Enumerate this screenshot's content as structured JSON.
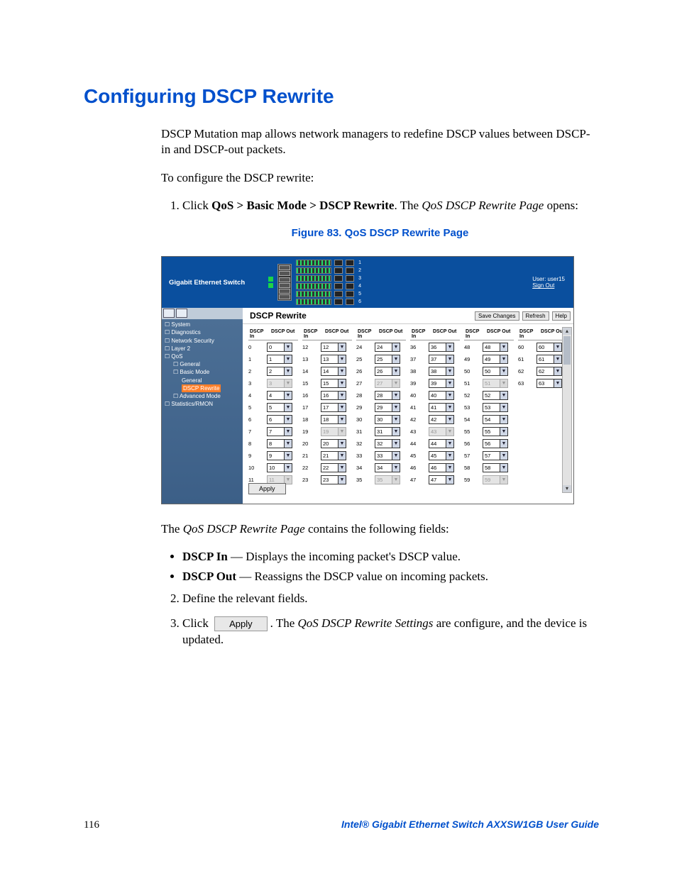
{
  "section_title": "Configuring DSCP Rewrite",
  "intro_paragraph": "DSCP Mutation map allows network managers to redefine DSCP values between DSCP-in and DSCP-out packets.",
  "procedure_intro": "To configure the DSCP rewrite:",
  "steps": {
    "s1_pre": "Click ",
    "s1_path": "QoS > Basic Mode > DSCP Rewrite",
    "s1_mid": ". The ",
    "s1_italic": "QoS DSCP Rewrite Page",
    "s1_post": " opens:",
    "s2": "Define the relevant fields.",
    "s3_pre": "Click ",
    "s3_mid": ". The ",
    "s3_italic": "QoS DSCP Rewrite Settings",
    "s3_post": " are configure, and the device is updated.",
    "inline_apply_label": "Apply"
  },
  "figure_caption": "Figure 83. QoS DSCP Rewrite Page",
  "screenshot": {
    "app_name": "Gigabit Ethernet Switch",
    "user_label": "User: user15",
    "sign_out": "Sign Out",
    "page_title": "DSCP Rewrite",
    "buttons": {
      "save": "Save Changes",
      "refresh": "Refresh",
      "help": "Help",
      "apply": "Apply"
    },
    "nav": {
      "system": "System",
      "diagnostics": "Diagnostics",
      "network_security": "Network Security",
      "layer2": "Layer 2",
      "qos": "QoS",
      "qos_general": "General",
      "basic_mode": "Basic Mode",
      "bm_general": "General",
      "dscp_rewrite": "DSCP Rewrite",
      "advanced_mode": "Advanced Mode",
      "statistics": "Statistics/RMON"
    },
    "table_headers": {
      "in": "DSCP In",
      "out": "DSCP Out"
    },
    "columns": [
      {
        "rows": [
          {
            "in": "0",
            "out": "0",
            "d": false
          },
          {
            "in": "1",
            "out": "1",
            "d": false
          },
          {
            "in": "2",
            "out": "2",
            "d": false
          },
          {
            "in": "3",
            "out": "3",
            "d": true
          },
          {
            "in": "4",
            "out": "4",
            "d": false
          },
          {
            "in": "5",
            "out": "5",
            "d": false
          },
          {
            "in": "6",
            "out": "6",
            "d": false
          },
          {
            "in": "7",
            "out": "7",
            "d": false
          },
          {
            "in": "8",
            "out": "8",
            "d": false
          },
          {
            "in": "9",
            "out": "9",
            "d": false
          },
          {
            "in": "10",
            "out": "10",
            "d": false
          },
          {
            "in": "11",
            "out": "11",
            "d": true
          }
        ]
      },
      {
        "rows": [
          {
            "in": "12",
            "out": "12",
            "d": false
          },
          {
            "in": "13",
            "out": "13",
            "d": false
          },
          {
            "in": "14",
            "out": "14",
            "d": false
          },
          {
            "in": "15",
            "out": "15",
            "d": false
          },
          {
            "in": "16",
            "out": "16",
            "d": false
          },
          {
            "in": "17",
            "out": "17",
            "d": false
          },
          {
            "in": "18",
            "out": "18",
            "d": false
          },
          {
            "in": "19",
            "out": "19",
            "d": true
          },
          {
            "in": "20",
            "out": "20",
            "d": false
          },
          {
            "in": "21",
            "out": "21",
            "d": false
          },
          {
            "in": "22",
            "out": "22",
            "d": false
          },
          {
            "in": "23",
            "out": "23",
            "d": false
          }
        ]
      },
      {
        "rows": [
          {
            "in": "24",
            "out": "24",
            "d": false
          },
          {
            "in": "25",
            "out": "25",
            "d": false
          },
          {
            "in": "26",
            "out": "26",
            "d": false
          },
          {
            "in": "27",
            "out": "27",
            "d": true
          },
          {
            "in": "28",
            "out": "28",
            "d": false
          },
          {
            "in": "29",
            "out": "29",
            "d": false
          },
          {
            "in": "30",
            "out": "30",
            "d": false
          },
          {
            "in": "31",
            "out": "31",
            "d": false
          },
          {
            "in": "32",
            "out": "32",
            "d": false
          },
          {
            "in": "33",
            "out": "33",
            "d": false
          },
          {
            "in": "34",
            "out": "34",
            "d": false
          },
          {
            "in": "35",
            "out": "35",
            "d": true
          }
        ]
      },
      {
        "rows": [
          {
            "in": "36",
            "out": "36",
            "d": false
          },
          {
            "in": "37",
            "out": "37",
            "d": false
          },
          {
            "in": "38",
            "out": "38",
            "d": false
          },
          {
            "in": "39",
            "out": "39",
            "d": false
          },
          {
            "in": "40",
            "out": "40",
            "d": false
          },
          {
            "in": "41",
            "out": "41",
            "d": false
          },
          {
            "in": "42",
            "out": "42",
            "d": false
          },
          {
            "in": "43",
            "out": "43",
            "d": true
          },
          {
            "in": "44",
            "out": "44",
            "d": false
          },
          {
            "in": "45",
            "out": "45",
            "d": false
          },
          {
            "in": "46",
            "out": "46",
            "d": false
          },
          {
            "in": "47",
            "out": "47",
            "d": false
          }
        ]
      },
      {
        "rows": [
          {
            "in": "48",
            "out": "48",
            "d": false
          },
          {
            "in": "49",
            "out": "49",
            "d": false
          },
          {
            "in": "50",
            "out": "50",
            "d": false
          },
          {
            "in": "51",
            "out": "51",
            "d": true
          },
          {
            "in": "52",
            "out": "52",
            "d": false
          },
          {
            "in": "53",
            "out": "53",
            "d": false
          },
          {
            "in": "54",
            "out": "54",
            "d": false
          },
          {
            "in": "55",
            "out": "55",
            "d": false
          },
          {
            "in": "56",
            "out": "56",
            "d": false
          },
          {
            "in": "57",
            "out": "57",
            "d": false
          },
          {
            "in": "58",
            "out": "58",
            "d": false
          },
          {
            "in": "59",
            "out": "59",
            "d": true
          }
        ]
      },
      {
        "rows": [
          {
            "in": "60",
            "out": "60",
            "d": false
          },
          {
            "in": "61",
            "out": "61",
            "d": false
          },
          {
            "in": "62",
            "out": "62",
            "d": false
          },
          {
            "in": "63",
            "out": "63",
            "d": false
          }
        ]
      }
    ]
  },
  "fields_intro_pre": "The ",
  "fields_intro_italic": "QoS DSCP Rewrite Page",
  "fields_intro_post": " contains the following fields:",
  "field_dscp_in_label": "DSCP In",
  "field_dscp_in_desc": " — Displays the incoming packet's DSCP value.",
  "field_dscp_out_label": "DSCP Out",
  "field_dscp_out_desc": " — Reassigns the DSCP value on incoming packets.",
  "footer_page": "116",
  "footer_title": "Intel® Gigabit Ethernet Switch AXXSW1GB User Guide"
}
